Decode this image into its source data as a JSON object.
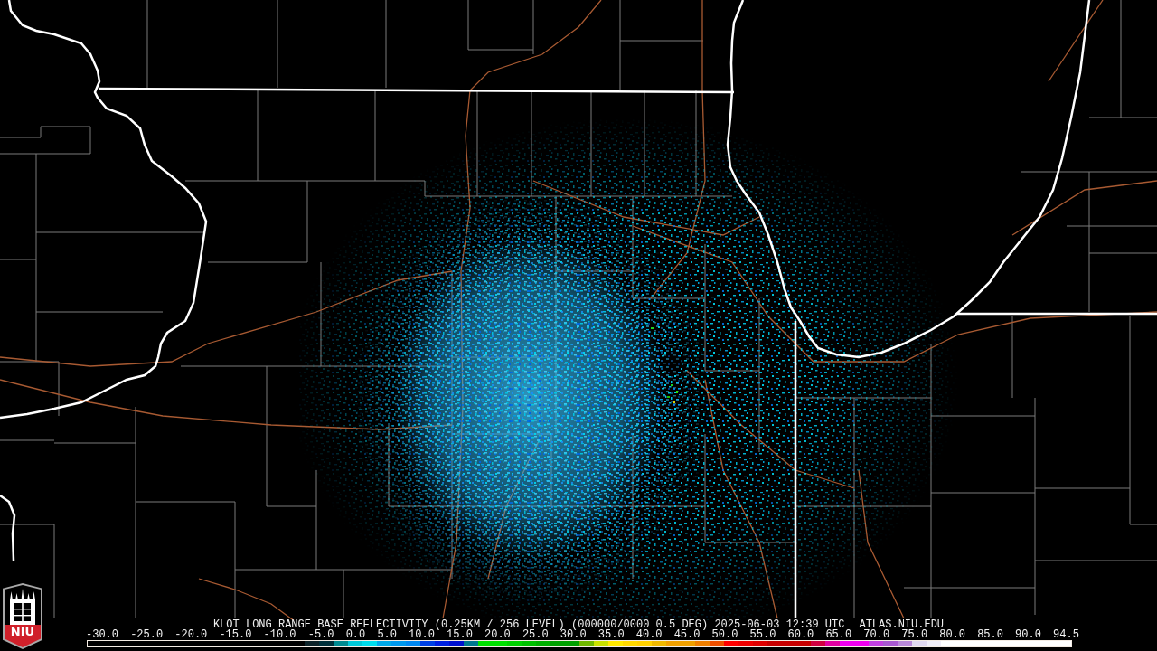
{
  "logo": {
    "text": "NIU"
  },
  "caption": {
    "product": "KLOT LONG RANGE BASE REFLECTIVITY (0.25KM / 256 LEVEL) (000000/0000 0.5 DEG) 2025-06-03 12:39 UTC",
    "source": "ATLAS.NIU.EDU"
  },
  "color_scale": {
    "labels": [
      "-30.0",
      "-25.0",
      "-20.0",
      "-15.0",
      "-10.0",
      "-5.0",
      "0.0",
      "5.0",
      "10.0",
      "15.0",
      "20.0",
      "25.0",
      "30.0",
      "35.0",
      "40.0",
      "45.0",
      "50.0",
      "55.0",
      "60.0",
      "65.0",
      "70.0",
      "75.0",
      "80.0",
      "85.0",
      "90.0",
      "94.5"
    ],
    "segments": [
      {
        "color": "#0c2228"
      },
      {
        "color": "#00303a"
      },
      {
        "color": "#008a90"
      },
      {
        "color": "#00c8d8"
      },
      {
        "color": "#00dcec"
      },
      {
        "color": "#00a8e8"
      },
      {
        "color": "#0098ec"
      },
      {
        "color": "#0088f0"
      },
      {
        "color": "#0040e4"
      },
      {
        "color": "#0020e0"
      },
      {
        "color": "#0010d0"
      },
      {
        "color": "#007890"
      },
      {
        "color": "#00e000"
      },
      {
        "color": "#00e000"
      },
      {
        "color": "#00d000"
      },
      {
        "color": "#00c000"
      },
      {
        "color": "#00b000"
      },
      {
        "color": "#00a000"
      },
      {
        "color": "#00a000"
      },
      {
        "color": "#70b800"
      },
      {
        "color": "#c8e000"
      },
      {
        "color": "#ffe800"
      },
      {
        "color": "#ffd800"
      },
      {
        "color": "#ffd000"
      },
      {
        "color": "#f0b800"
      },
      {
        "color": "#f0a000"
      },
      {
        "color": "#f0a000"
      },
      {
        "color": "#f08000"
      },
      {
        "color": "#f05000"
      },
      {
        "color": "#ff0000"
      },
      {
        "color": "#f00000"
      },
      {
        "color": "#e00000"
      },
      {
        "color": "#c80000"
      },
      {
        "color": "#c80000"
      },
      {
        "color": "#c80000"
      },
      {
        "color": "#d00040"
      },
      {
        "color": "#e000a0"
      },
      {
        "color": "#f000f0"
      },
      {
        "color": "#f000f0"
      },
      {
        "color": "#c040e0"
      },
      {
        "color": "#a858d0"
      },
      {
        "color": "#b888d8"
      },
      {
        "color": "#e0d8f0"
      },
      {
        "color": "#f0eef8"
      },
      {
        "color": "#ffffff"
      },
      {
        "color": "#ffffff"
      },
      {
        "color": "#ffffff"
      },
      {
        "color": "#ffffff"
      },
      {
        "color": "#ffffff"
      },
      {
        "color": "#ffffff"
      },
      {
        "color": "#ffffff"
      },
      {
        "color": "#ffffff"
      },
      {
        "color": "#ffffff"
      }
    ]
  }
}
